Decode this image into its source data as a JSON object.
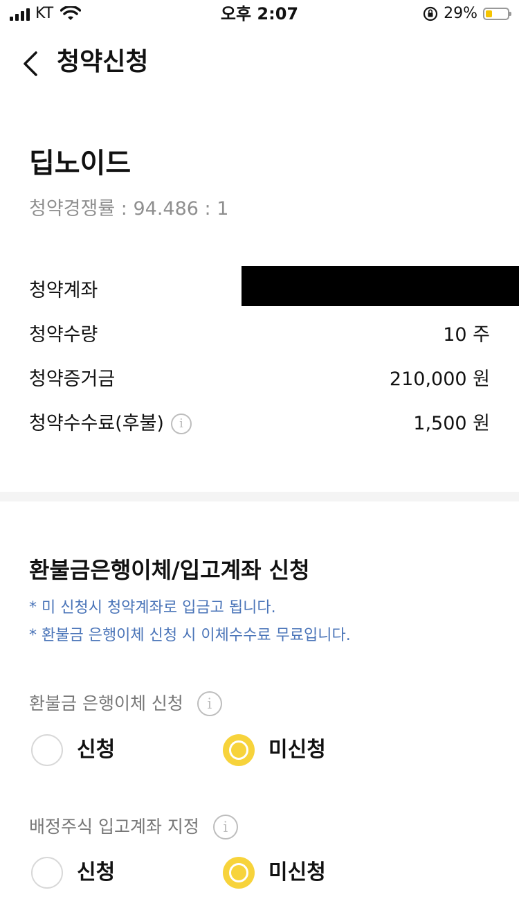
{
  "status_bar": {
    "carrier": "KT",
    "time": "오후 2:07",
    "battery_percent": "29%",
    "battery_level": 0.29,
    "battery_color": "#f5c400"
  },
  "header": {
    "back_icon": "chevron-left-icon",
    "title": "청약신청"
  },
  "stock": {
    "name": "딥노이드",
    "ratio_text": "청약경쟁률 : 94.486 : 1"
  },
  "details": {
    "account_label": "청약계좌",
    "quantity_label": "청약수량",
    "quantity_value": "10 주",
    "deposit_label": "청약증거금",
    "deposit_value": "210,000 원",
    "fee_label": "청약수수료(후불)",
    "fee_value": "1,500 원"
  },
  "refund_section": {
    "title": "환불금은행이체/입고계좌 신청",
    "notes": [
      "* 미 신청시 청약계좌로 입금고 됩니다.",
      "* 환불금 은행이체 신청 시 이체수수료 무료입니다."
    ],
    "note_color": "#4a74b8",
    "bank_transfer": {
      "label": "환불금 은행이체 신청",
      "option_apply": "신청",
      "option_not_apply": "미신청",
      "selected": "미신청"
    },
    "stock_account": {
      "label": "배정주식 입고계좌 지정",
      "option_apply": "신청",
      "option_not_apply": "미신청",
      "selected": "미신청"
    }
  },
  "accent_color": "#f7d33b"
}
